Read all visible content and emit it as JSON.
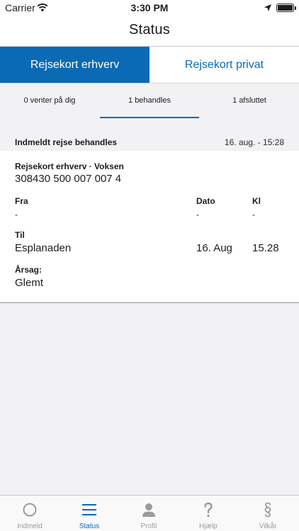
{
  "statusbar": {
    "carrier": "Carrier",
    "time": "3:30 PM"
  },
  "navbar": {
    "title": "Status"
  },
  "segments": [
    {
      "label": "Rejsekort erhverv"
    },
    {
      "label": "Rejsekort privat"
    }
  ],
  "subtabs": [
    {
      "label": "0 venter på dig"
    },
    {
      "label": "1 behandles"
    },
    {
      "label": "1 afsluttet"
    }
  ],
  "card": {
    "header_left": "Indmeldt rejse behandles",
    "header_right": "16. aug. - 15:28",
    "card_type": "Rejsekort erhverv · Voksen",
    "card_number": "308430 500 007 007 4",
    "fra_label": "Fra",
    "dato_label": "Dato",
    "kl_label": "Kl",
    "fra_value": "-",
    "dato_value": "-",
    "kl_value": "-",
    "til_label": "Til",
    "til_value": "Esplanaden",
    "til_dato": "16. Aug",
    "til_kl": "15.28",
    "aarsag_label": "Årsag:",
    "aarsag_value": "Glemt"
  },
  "tabbar": [
    {
      "label": "Indmeld",
      "icon": "circle-icon"
    },
    {
      "label": "Status",
      "icon": "list-icon"
    },
    {
      "label": "Profil",
      "icon": "person-icon"
    },
    {
      "label": "Hjælp",
      "icon": "question-icon"
    },
    {
      "label": "Vilkår",
      "icon": "paragraph-icon"
    }
  ],
  "colors": {
    "accent": "#0a6ab3",
    "inactive_tab": "#9b9ba0"
  }
}
